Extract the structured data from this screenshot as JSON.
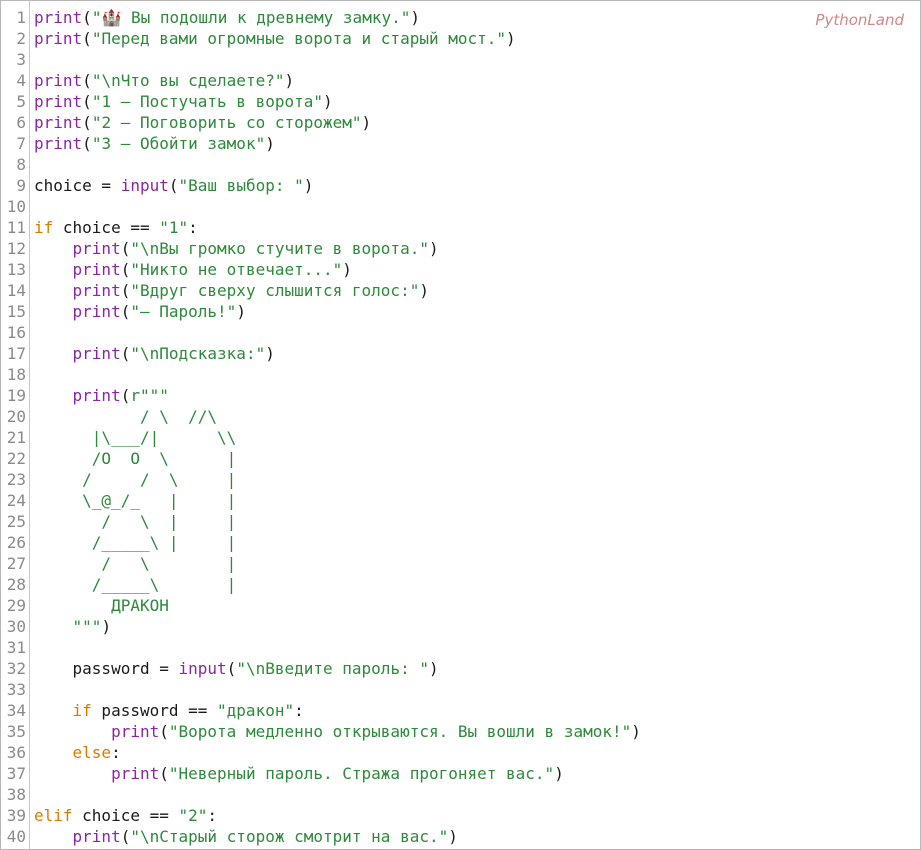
{
  "brand": "PythonLand",
  "colors": {
    "builtin": "#8a26a6",
    "keyword": "#d97a00",
    "string": "#2d8a3a",
    "text": "#1a1a1a",
    "line_number": "#8a8a8a"
  },
  "lines": [
    {
      "n": "1",
      "t": [
        {
          "c": "builtin",
          "s": "print"
        },
        {
          "c": "text",
          "s": "("
        },
        {
          "c": "string",
          "s": "\"🏰 Вы подошли к древнему замку.\""
        },
        {
          "c": "text",
          "s": ")"
        }
      ]
    },
    {
      "n": "2",
      "t": [
        {
          "c": "builtin",
          "s": "print"
        },
        {
          "c": "text",
          "s": "("
        },
        {
          "c": "string",
          "s": "\"Перед вами огромные ворота и старый мост.\""
        },
        {
          "c": "text",
          "s": ")"
        }
      ]
    },
    {
      "n": "3",
      "t": []
    },
    {
      "n": "4",
      "t": [
        {
          "c": "builtin",
          "s": "print"
        },
        {
          "c": "text",
          "s": "("
        },
        {
          "c": "string",
          "s": "\"\\nЧто вы сделаете?\""
        },
        {
          "c": "text",
          "s": ")"
        }
      ]
    },
    {
      "n": "5",
      "t": [
        {
          "c": "builtin",
          "s": "print"
        },
        {
          "c": "text",
          "s": "("
        },
        {
          "c": "string",
          "s": "\"1 — Постучать в ворота\""
        },
        {
          "c": "text",
          "s": ")"
        }
      ]
    },
    {
      "n": "6",
      "t": [
        {
          "c": "builtin",
          "s": "print"
        },
        {
          "c": "text",
          "s": "("
        },
        {
          "c": "string",
          "s": "\"2 — Поговорить со сторожем\""
        },
        {
          "c": "text",
          "s": ")"
        }
      ]
    },
    {
      "n": "7",
      "t": [
        {
          "c": "builtin",
          "s": "print"
        },
        {
          "c": "text",
          "s": "("
        },
        {
          "c": "string",
          "s": "\"3 — Обойти замок\""
        },
        {
          "c": "text",
          "s": ")"
        }
      ]
    },
    {
      "n": "8",
      "t": []
    },
    {
      "n": "9",
      "t": [
        {
          "c": "text",
          "s": "choice = "
        },
        {
          "c": "builtin",
          "s": "input"
        },
        {
          "c": "text",
          "s": "("
        },
        {
          "c": "string",
          "s": "\"Ваш выбор: \""
        },
        {
          "c": "text",
          "s": ")"
        }
      ]
    },
    {
      "n": "10",
      "t": []
    },
    {
      "n": "11",
      "t": [
        {
          "c": "keyword",
          "s": "if"
        },
        {
          "c": "text",
          "s": " choice == "
        },
        {
          "c": "string",
          "s": "\"1\""
        },
        {
          "c": "text",
          "s": ":"
        }
      ]
    },
    {
      "n": "12",
      "t": [
        {
          "c": "text",
          "s": "    "
        },
        {
          "c": "builtin",
          "s": "print"
        },
        {
          "c": "text",
          "s": "("
        },
        {
          "c": "string",
          "s": "\"\\nВы громко стучите в ворота.\""
        },
        {
          "c": "text",
          "s": ")"
        }
      ]
    },
    {
      "n": "13",
      "t": [
        {
          "c": "text",
          "s": "    "
        },
        {
          "c": "builtin",
          "s": "print"
        },
        {
          "c": "text",
          "s": "("
        },
        {
          "c": "string",
          "s": "\"Никто не отвечает...\""
        },
        {
          "c": "text",
          "s": ")"
        }
      ]
    },
    {
      "n": "14",
      "t": [
        {
          "c": "text",
          "s": "    "
        },
        {
          "c": "builtin",
          "s": "print"
        },
        {
          "c": "text",
          "s": "("
        },
        {
          "c": "string",
          "s": "\"Вдруг сверху слышится голос:\""
        },
        {
          "c": "text",
          "s": ")"
        }
      ]
    },
    {
      "n": "15",
      "t": [
        {
          "c": "text",
          "s": "    "
        },
        {
          "c": "builtin",
          "s": "print"
        },
        {
          "c": "text",
          "s": "("
        },
        {
          "c": "string",
          "s": "\"— Пароль!\""
        },
        {
          "c": "text",
          "s": ")"
        }
      ]
    },
    {
      "n": "16",
      "t": []
    },
    {
      "n": "17",
      "t": [
        {
          "c": "text",
          "s": "    "
        },
        {
          "c": "builtin",
          "s": "print"
        },
        {
          "c": "text",
          "s": "("
        },
        {
          "c": "string",
          "s": "\"\\nПодсказка:\""
        },
        {
          "c": "text",
          "s": ")"
        }
      ]
    },
    {
      "n": "18",
      "t": []
    },
    {
      "n": "19",
      "t": [
        {
          "c": "text",
          "s": "    "
        },
        {
          "c": "builtin",
          "s": "print"
        },
        {
          "c": "text",
          "s": "("
        },
        {
          "c": "string",
          "s": "r\"\"\""
        }
      ]
    },
    {
      "n": "20",
      "t": [
        {
          "c": "string",
          "s": "           / \\  //\\"
        }
      ]
    },
    {
      "n": "21",
      "t": [
        {
          "c": "string",
          "s": "      |\\___/|      \\\\"
        }
      ]
    },
    {
      "n": "22",
      "t": [
        {
          "c": "string",
          "s": "      /O  O  \\      |"
        }
      ]
    },
    {
      "n": "23",
      "t": [
        {
          "c": "string",
          "s": "     /     /  \\     |"
        }
      ]
    },
    {
      "n": "24",
      "t": [
        {
          "c": "string",
          "s": "     \\_@_/_   |     |"
        }
      ]
    },
    {
      "n": "25",
      "t": [
        {
          "c": "string",
          "s": "       /   \\  |     |"
        }
      ]
    },
    {
      "n": "26",
      "t": [
        {
          "c": "string",
          "s": "      /_____\\ |     |"
        }
      ]
    },
    {
      "n": "27",
      "t": [
        {
          "c": "string",
          "s": "       /   \\        |"
        }
      ]
    },
    {
      "n": "28",
      "t": [
        {
          "c": "string",
          "s": "      /_____\\       |"
        }
      ]
    },
    {
      "n": "29",
      "t": [
        {
          "c": "string",
          "s": "        ДРАКОН"
        }
      ]
    },
    {
      "n": "30",
      "t": [
        {
          "c": "string",
          "s": "    \"\"\""
        },
        {
          "c": "text",
          "s": ")"
        }
      ]
    },
    {
      "n": "31",
      "t": []
    },
    {
      "n": "32",
      "t": [
        {
          "c": "text",
          "s": "    password = "
        },
        {
          "c": "builtin",
          "s": "input"
        },
        {
          "c": "text",
          "s": "("
        },
        {
          "c": "string",
          "s": "\"\\nВведите пароль: \""
        },
        {
          "c": "text",
          "s": ")"
        }
      ]
    },
    {
      "n": "33",
      "t": []
    },
    {
      "n": "34",
      "t": [
        {
          "c": "text",
          "s": "    "
        },
        {
          "c": "keyword",
          "s": "if"
        },
        {
          "c": "text",
          "s": " password == "
        },
        {
          "c": "string",
          "s": "\"дракон\""
        },
        {
          "c": "text",
          "s": ":"
        }
      ]
    },
    {
      "n": "35",
      "t": [
        {
          "c": "text",
          "s": "        "
        },
        {
          "c": "builtin",
          "s": "print"
        },
        {
          "c": "text",
          "s": "("
        },
        {
          "c": "string",
          "s": "\"Ворота медленно открываются. Вы вошли в замок!\""
        },
        {
          "c": "text",
          "s": ")"
        }
      ]
    },
    {
      "n": "36",
      "t": [
        {
          "c": "text",
          "s": "    "
        },
        {
          "c": "keyword",
          "s": "else"
        },
        {
          "c": "text",
          "s": ":"
        }
      ]
    },
    {
      "n": "37",
      "t": [
        {
          "c": "text",
          "s": "        "
        },
        {
          "c": "builtin",
          "s": "print"
        },
        {
          "c": "text",
          "s": "("
        },
        {
          "c": "string",
          "s": "\"Неверный пароль. Стража прогоняет вас.\""
        },
        {
          "c": "text",
          "s": ")"
        }
      ]
    },
    {
      "n": "38",
      "t": []
    },
    {
      "n": "39",
      "t": [
        {
          "c": "keyword",
          "s": "elif"
        },
        {
          "c": "text",
          "s": " choice == "
        },
        {
          "c": "string",
          "s": "\"2\""
        },
        {
          "c": "text",
          "s": ":"
        }
      ]
    },
    {
      "n": "40",
      "t": [
        {
          "c": "text",
          "s": "    "
        },
        {
          "c": "builtin",
          "s": "print"
        },
        {
          "c": "text",
          "s": "("
        },
        {
          "c": "string",
          "s": "\"\\nСтарый сторож смотрит на вас.\""
        },
        {
          "c": "text",
          "s": ")"
        }
      ]
    }
  ]
}
